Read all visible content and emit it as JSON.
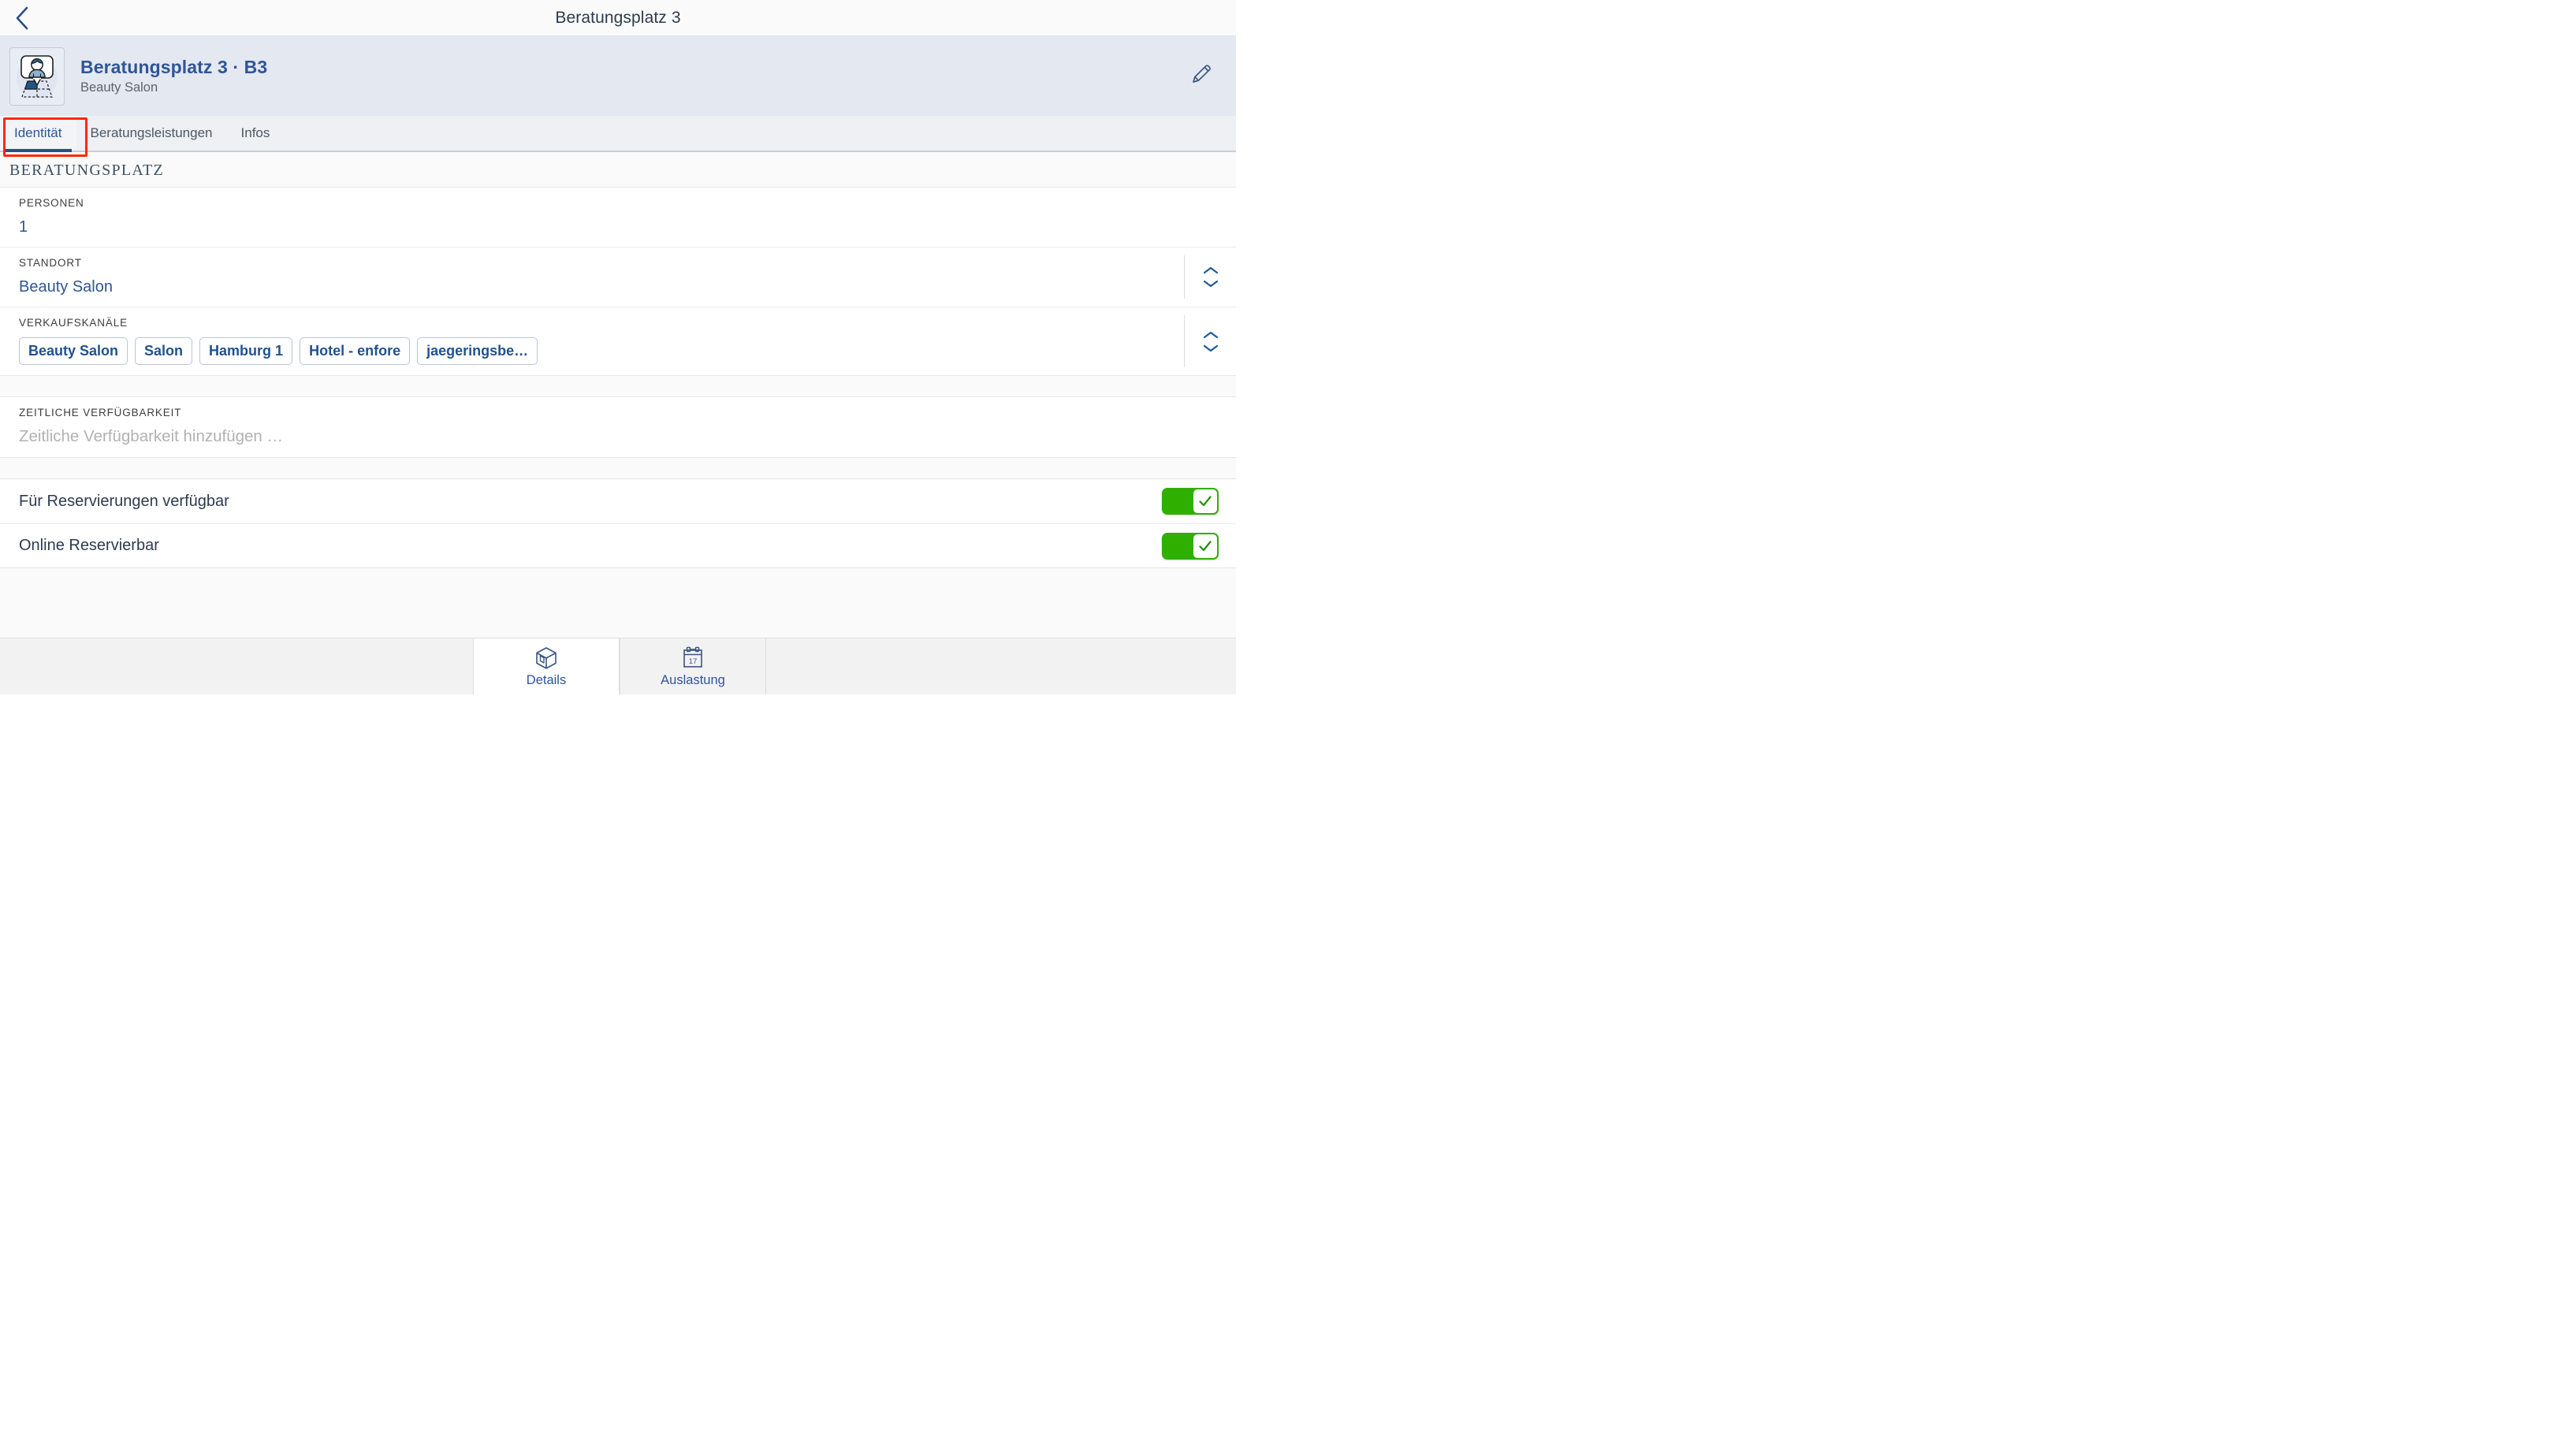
{
  "titlebar": {
    "back_icon": "chevron-left-icon",
    "title": "Beratungsplatz 3"
  },
  "entity_header": {
    "thumbnail_icon": "consultation-seat-icon",
    "title": "Beratungsplatz 3 · B3",
    "subtitle": "Beauty Salon",
    "edit_icon": "pencil-icon"
  },
  "tabs": [
    {
      "label": "Identität",
      "active": true,
      "highlighted": true
    },
    {
      "label": "Beratungsleistungen",
      "active": false,
      "highlighted": false
    },
    {
      "label": "Infos",
      "active": false,
      "highlighted": false
    }
  ],
  "section": {
    "title": "BERATUNGSPLATZ"
  },
  "fields": {
    "personen": {
      "label": "PERSONEN",
      "value": "1"
    },
    "standort": {
      "label": "STANDORT",
      "value": "Beauty Salon",
      "stepper_icon": "chevron-up-down-icon"
    },
    "verkaufskanaele": {
      "label": "VERKAUFSKANÄLE",
      "chips": [
        "Beauty Salon",
        "Salon",
        "Hamburg 1",
        "Hotel - enfore",
        "jaegeringsbe…"
      ],
      "stepper_icon": "chevron-up-down-icon"
    },
    "zeitliche_verfuegbarkeit": {
      "label": "ZEITLICHE VERFÜGBARKEIT",
      "placeholder": "Zeitliche Verfügbarkeit hinzufügen …"
    }
  },
  "toggles": [
    {
      "label": "Für Reservierungen verfügbar",
      "state": "on"
    },
    {
      "label": "Online Reservierbar",
      "state": "on"
    }
  ],
  "bottom_nav": [
    {
      "label": "Details",
      "icon": "box-3d-icon",
      "active": true
    },
    {
      "label": "Auslastung",
      "icon": "calendar-icon",
      "calendar_day": "17",
      "active": false
    }
  ],
  "colors": {
    "accent_blue": "#2f5596",
    "deep_blue": "#2b4d88",
    "toggle_green": "#2fb000",
    "highlight_red": "#fc2b0c",
    "header_bg": "#e4e8f0",
    "tabstrip_bg": "#eef0f3"
  }
}
